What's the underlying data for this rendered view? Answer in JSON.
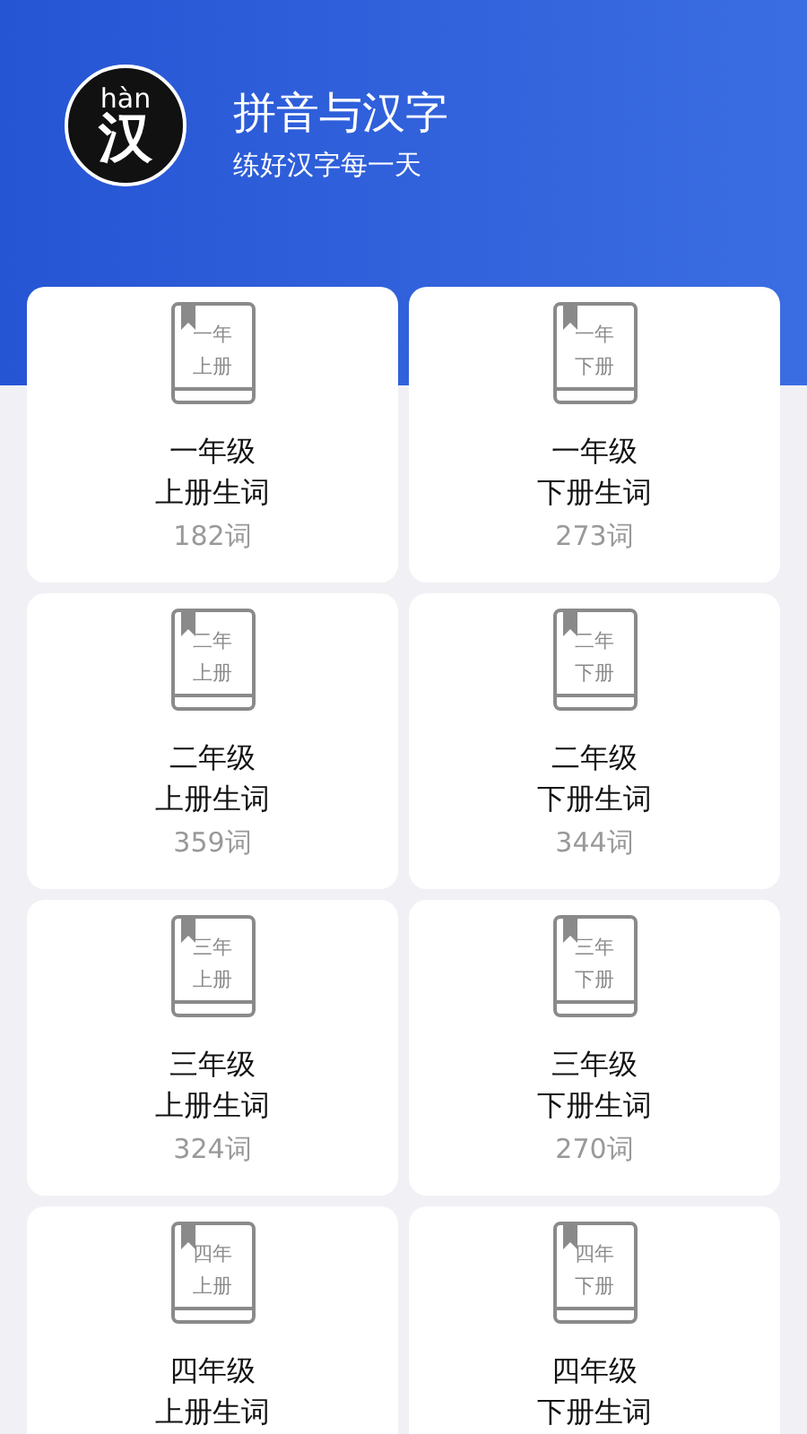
{
  "header": {
    "logo_pinyin": "hàn",
    "logo_char": "汉",
    "title": "拼音与汉字",
    "subtitle": "练好汉字每一天"
  },
  "books": [
    {
      "cover_top": "一年",
      "cover_bottom": "上册",
      "grade": "一年级",
      "volume": "上册生词",
      "count": "182词"
    },
    {
      "cover_top": "一年",
      "cover_bottom": "下册",
      "grade": "一年级",
      "volume": "下册生词",
      "count": "273词"
    },
    {
      "cover_top": "二年",
      "cover_bottom": "上册",
      "grade": "二年级",
      "volume": "上册生词",
      "count": "359词"
    },
    {
      "cover_top": "二年",
      "cover_bottom": "下册",
      "grade": "二年级",
      "volume": "下册生词",
      "count": "344词"
    },
    {
      "cover_top": "三年",
      "cover_bottom": "上册",
      "grade": "三年级",
      "volume": "上册生词",
      "count": "324词"
    },
    {
      "cover_top": "三年",
      "cover_bottom": "下册",
      "grade": "三年级",
      "volume": "下册生词",
      "count": "270词"
    },
    {
      "cover_top": "四年",
      "cover_bottom": "上册",
      "grade": "四年级",
      "volume": "上册生词"
    },
    {
      "cover_top": "四年",
      "cover_bottom": "下册",
      "grade": "四年级",
      "volume": "下册生词"
    }
  ]
}
